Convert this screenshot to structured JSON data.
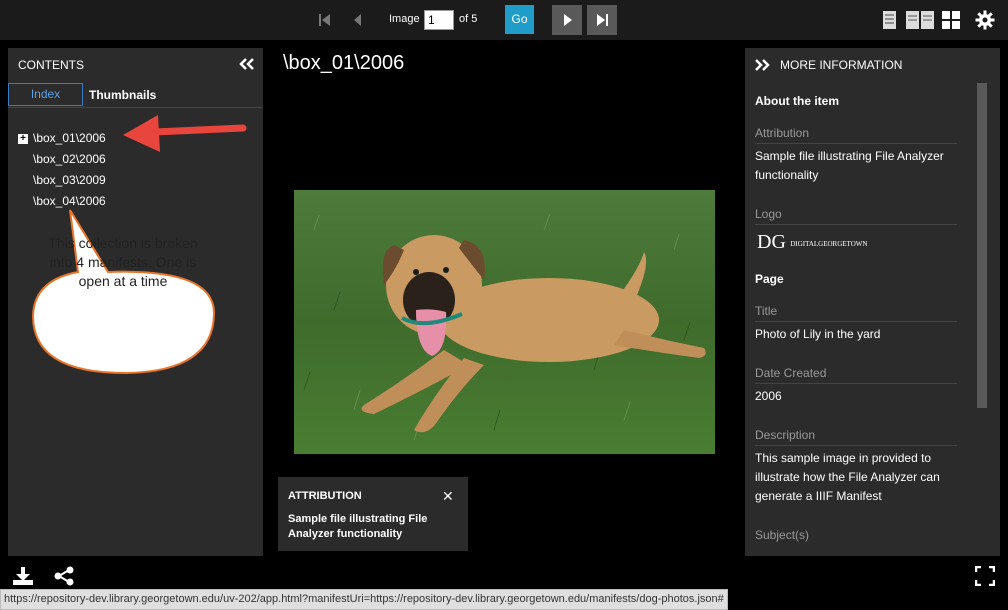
{
  "toolbar": {
    "image_label": "Image",
    "image_value": "1",
    "of_label": "of 5",
    "go_label": "Go"
  },
  "left_panel": {
    "title": "CONTENTS",
    "tabs": [
      {
        "label": "Index",
        "active": true
      },
      {
        "label": "Thumbnails",
        "active": false
      }
    ],
    "tree": [
      {
        "label": "\\box_01\\2006",
        "expandable": true
      },
      {
        "label": "\\box_02\\2006",
        "expandable": false
      },
      {
        "label": "\\box_03\\2009",
        "expandable": false
      },
      {
        "label": "\\box_04\\2006",
        "expandable": false
      }
    ]
  },
  "annotation": {
    "text": "This collection is broken into 4 manifests.  One is open at a time",
    "arrow_color": "#e8453c",
    "bubble_border": "#e8742a"
  },
  "center": {
    "title": "\\box_01\\2006",
    "attribution": {
      "heading": "ATTRIBUTION",
      "close": "✕",
      "text": "Sample file illustrating File Analyzer functionality"
    }
  },
  "right_panel": {
    "title": "MORE INFORMATION",
    "item_heading": "About the item",
    "attribution_label": "Attribution",
    "attribution_value": "Sample file illustrating File Analyzer functionality",
    "logo_label": "Logo",
    "logo_text_dg": "DG",
    "logo_text_name": "DIGITALGEORGETOWN",
    "page_heading": "Page",
    "title_label": "Title",
    "title_value": "Photo of Lily in the yard",
    "date_label": "Date Created",
    "date_value": "2006",
    "description_label": "Description",
    "description_value": "This sample image in provided to illustrate how the File Analyzer can generate a IIIF Manifest",
    "subjects_label": "Subject(s)"
  },
  "status_bar": {
    "url": "https://repository-dev.library.georgetown.edu/uv-202/app.html?manifestUri=https://repository-dev.library.georgetown.edu/manifests/dog-photos.json#"
  },
  "colors": {
    "accent": "#1f9cc7",
    "panel_bg": "#2b2b2b",
    "topbar_bg": "#1b1b1b"
  }
}
